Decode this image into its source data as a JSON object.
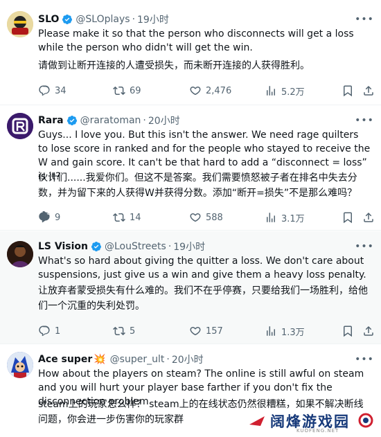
{
  "tweets": [
    {
      "name": "SLO",
      "name_suffix": "",
      "handle": "@SLOplays",
      "time": "19小时",
      "text_en": "Please make it so that the person who disconnects will get a loss while the person who didn't will get the win.",
      "text_zh": "请做到让断开连接的人遭受损失，而未断开连接的人获得胜利。",
      "replies": "34",
      "retweets": "69",
      "likes": "2,476",
      "views": "5.2万",
      "avatar_color": "#c9a227"
    },
    {
      "name": "Rara",
      "name_suffix": "",
      "handle": "@raratoman",
      "time": "20小时",
      "text_en": "Guys... I love you. But this isn't the answer. We need rage quilters to lose score in ranked and for the people who stayed to receive the W and gain score. It can't be that hard to add a “disconnect = loss” is it?",
      "text_zh": "伙计们......我爱你们。但这不是答案。我们需要愤怒被子者在排名中失去分数，并为留下来的人获得W并获得分数。添加“断开=损失”不是那么难吗？",
      "replies": "9",
      "retweets": "14",
      "likes": "588",
      "views": "3.1万",
      "avatar_color": "#3b1a6b"
    },
    {
      "name": "LS Vision",
      "name_suffix": "",
      "handle": "@LouStreets",
      "time": "19小时",
      "text_en": "What's so hard about giving the quitter a loss. We don't care about suspensions, just give us a win and give them a heavy loss penalty.",
      "text_zh": "让放弃者蒙受损失有什么难的。我们不在乎停赛，只要给我们一场胜利，给他们一个沉重的失利处罚。",
      "replies": "1",
      "retweets": "5",
      "likes": "157",
      "views": "1.3万",
      "avatar_color": "#4a2a1a"
    },
    {
      "name": "Ace super",
      "name_suffix": "💥",
      "handle": "@super_ult",
      "time": "20小时",
      "text_en": "How about the players on steam? The online is still awful on steam and you will hurt your player base farther if you don't fix the disconnection problem",
      "text_zh": "steam上的玩家怎么样？ steam上的在线状态仍然很糟糕，如果不解决断线问题，你会进一步伤害你的玩家群",
      "avatar_color": "#2a4fb0"
    }
  ],
  "icons": {
    "more": "more-icon",
    "reply": "reply-icon",
    "retweet": "retweet-icon",
    "like": "heart-icon",
    "views": "views-icon",
    "bookmark": "bookmark-icon",
    "share": "share-icon",
    "verified": "verified-badge-icon"
  },
  "colors": {
    "verified": "#1d9bf0",
    "muted": "#536471",
    "text": "#0f1419",
    "watermark": "#173a7a"
  },
  "watermark": {
    "text": "阔烽游戏园",
    "sub": "KUOFENG.NET"
  }
}
